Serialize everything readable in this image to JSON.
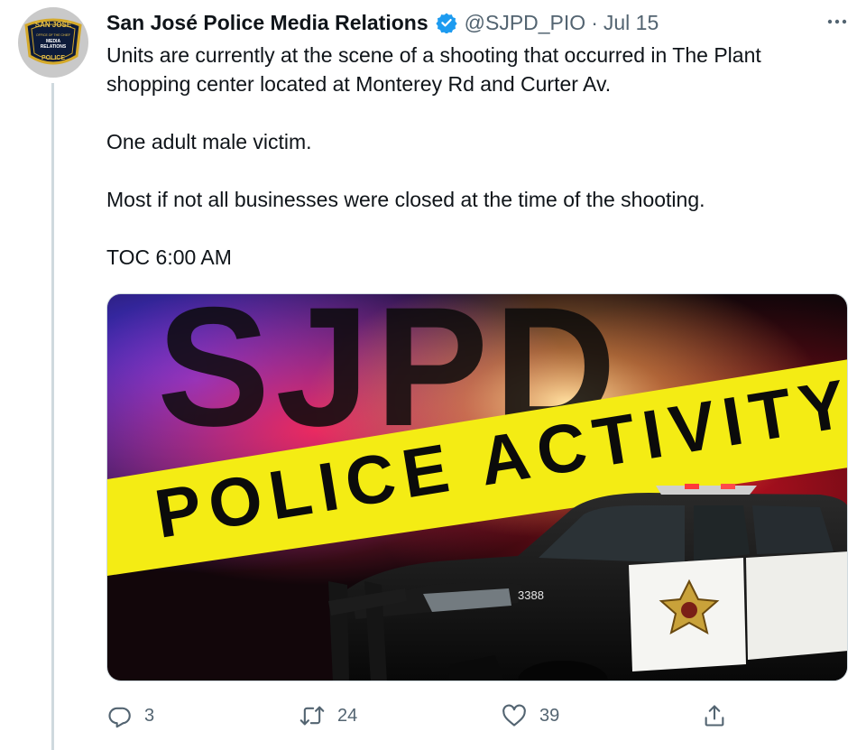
{
  "tweet": {
    "author_name": "San José Police Media Relations",
    "handle": "@SJPD_PIO",
    "separator": "·",
    "date": "Jul 15",
    "text_lines": [
      "Units are currently at the scene of a shooting that occurred in The Plant",
      "shopping center located at Monterey Rd and Curter Av.",
      "One adult male victim.",
      "Most if not all businesses were closed at the time of the shooting.",
      "TOC 6:00 AM"
    ]
  },
  "avatar": {
    "arc_top": "SAN JOSE",
    "center_small": "OFFICE OF THE CHIEF",
    "center_title1": "MEDIA",
    "center_title2": "RELATIONS",
    "arc_bottom": "POLICE"
  },
  "media": {
    "big_text": "SJPD",
    "banner_text": "POLICE ACTIVITY",
    "car_number": "3388"
  },
  "actions": {
    "reply_count": "3",
    "retweet_count": "24",
    "like_count": "39"
  },
  "colors": {
    "text": "#0f1419",
    "secondary": "#536471",
    "verified": "#1d9bf0",
    "banner": "#f4ec14"
  },
  "icons": [
    "verified-badge-icon",
    "more-icon",
    "reply-icon",
    "retweet-icon",
    "like-icon",
    "share-icon"
  ]
}
